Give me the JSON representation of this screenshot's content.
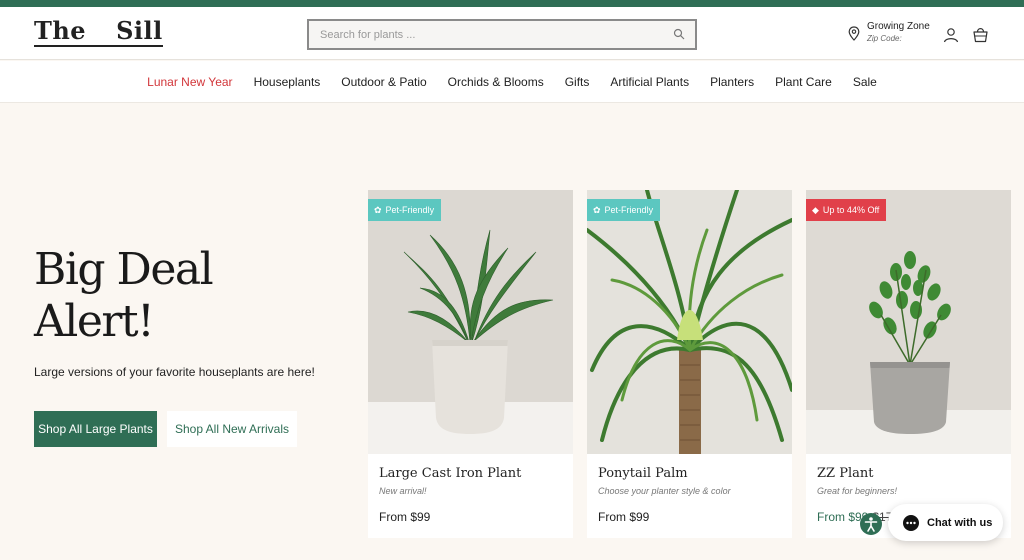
{
  "brand": {
    "word1": "The",
    "word2": "Sill"
  },
  "search": {
    "placeholder": "Search for plants ..."
  },
  "zone": {
    "title": "Growing Zone",
    "subtitle": "Zip Code:"
  },
  "nav": [
    {
      "label": "Lunar New Year",
      "highlight": true
    },
    {
      "label": "Houseplants"
    },
    {
      "label": "Outdoor & Patio"
    },
    {
      "label": "Orchids & Blooms"
    },
    {
      "label": "Gifts"
    },
    {
      "label": "Artificial Plants"
    },
    {
      "label": "Planters"
    },
    {
      "label": "Plant Care"
    },
    {
      "label": "Sale"
    }
  ],
  "hero": {
    "title_line1": "Big Deal",
    "title_line2": "Alert!",
    "subtitle": "Large versions of your favorite houseplants are here!",
    "primary_button": "Shop All Large Plants",
    "secondary_button": "Shop All New Arrivals"
  },
  "products": [
    {
      "name": "Large Cast Iron Plant",
      "desc": "New arrival!",
      "price": "From $99",
      "badge": "Pet-Friendly",
      "badge_icon": "paw-icon",
      "badge_color": "#5cc7c0"
    },
    {
      "name": "Ponytail Palm",
      "desc": "Choose your planter style & color",
      "price": "From $99",
      "badge": "Pet-Friendly",
      "badge_icon": "paw-icon",
      "badge_color": "#5cc7c0"
    },
    {
      "name": "ZZ Plant",
      "desc": "Great for beginners!",
      "price": "From $99",
      "old_price": "$17",
      "badge": "Up to 44% Off",
      "badge_icon": "tag-icon",
      "badge_color": "#e1404a"
    }
  ],
  "chat": {
    "label": "Chat with us"
  },
  "colors": {
    "brand_green": "#2f6e55",
    "sale_red": "#d2363a",
    "background": "#fbf7f2"
  }
}
